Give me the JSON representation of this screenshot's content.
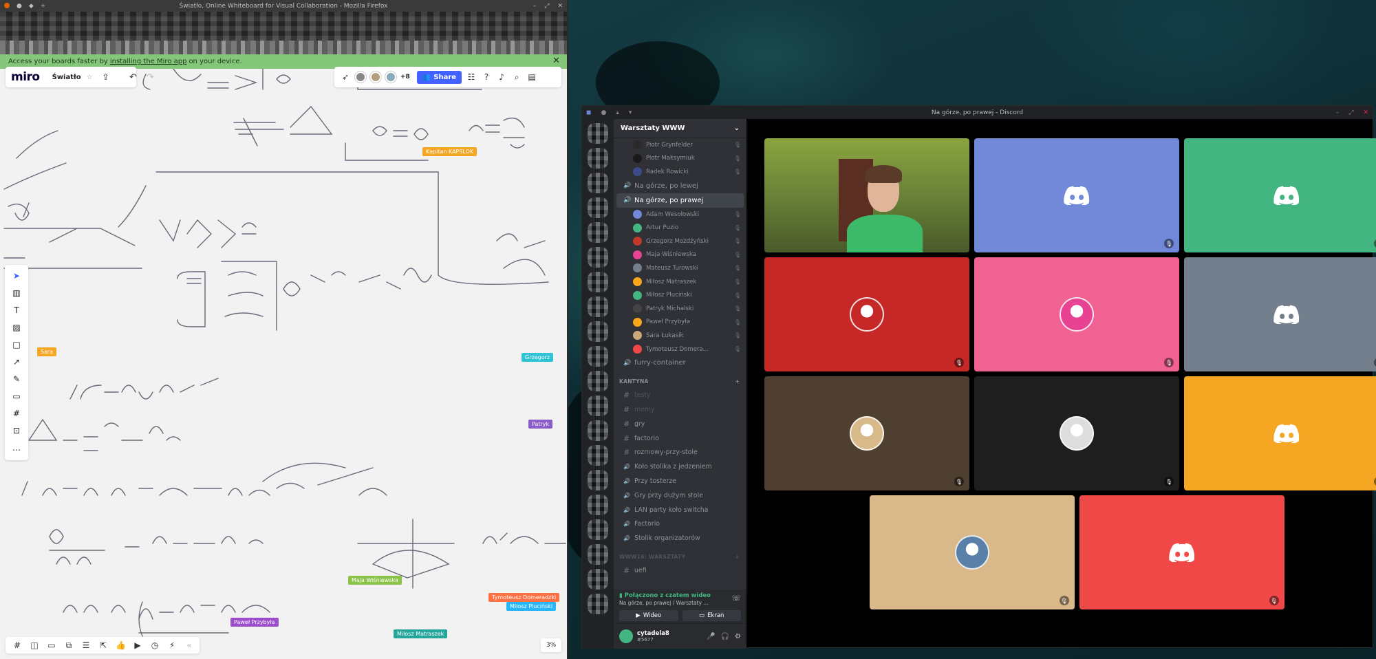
{
  "firefox": {
    "title": "Światło, Online Whiteboard for Visual Collaboration - Mozilla Firefox"
  },
  "miro": {
    "banner": {
      "text_before": "Access your boards faster by",
      "link": "installing the Miro app",
      "text_after": "on your device."
    },
    "logo": "miro",
    "board_name": "Światło",
    "collaborators_more": "+8",
    "share_label": "Share",
    "zoom": "3%",
    "cursors": [
      {
        "name": "Kapitan KAPSLOK",
        "color": "#f5a623"
      },
      {
        "name": "Sara",
        "color": "#f5a623"
      },
      {
        "name": "Grzegorz",
        "color": "#2fc3d6"
      },
      {
        "name": "Patryk",
        "color": "#8a5cc7"
      },
      {
        "name": "Maja Wiśniewska",
        "color": "#8bc34a"
      },
      {
        "name": "Paweł Przybyła",
        "color": "#9c4dcc"
      },
      {
        "name": "Miłosz Matraszek",
        "color": "#26a69a"
      },
      {
        "name": "Tymoteusz Domeradzki",
        "color": "#ff7043"
      },
      {
        "name": "Miłosz Pluciński",
        "color": "#29b6f6"
      }
    ]
  },
  "discord": {
    "window_title": "Na górze, po prawej - Discord",
    "server_name": "Warsztaty WWW",
    "top_users": [
      {
        "name": "Piotr Grynfelder",
        "color": "#2a2a2a"
      },
      {
        "name": "Piotr Maksymiuk",
        "color": "#1a1a1a"
      },
      {
        "name": "Radek Rowicki",
        "color": "#3a4a8a"
      }
    ],
    "voice_channels": [
      {
        "name": "Na górze, po lewej",
        "active": false
      },
      {
        "name": "Na górze, po prawej",
        "active": true
      }
    ],
    "channel_users": [
      {
        "name": "Adam Wesołowski",
        "color": "#7289da"
      },
      {
        "name": "Artur Puzio",
        "color": "#43b581"
      },
      {
        "name": "Grzegorz Możdżyński",
        "color": "#c0392b"
      },
      {
        "name": "Maja Wiśniewska",
        "color": "#e84393"
      },
      {
        "name": "Mateusz Turowski",
        "color": "#747f8d"
      },
      {
        "name": "Miłosz Matraszek",
        "color": "#faa61a"
      },
      {
        "name": "Miłosz Pluciński",
        "color": "#43b581"
      },
      {
        "name": "Patryk Michalski",
        "color": "#444"
      },
      {
        "name": "Paweł Przybyła",
        "color": "#faa61a"
      },
      {
        "name": "Sara Łukasik",
        "color": "#c9a97a"
      },
      {
        "name": "Tymoteusz Domera...",
        "color": "#f04747"
      }
    ],
    "other_voice_channel": "furry-container",
    "category_kantyna": "KANTYNA",
    "text_channels": [
      {
        "name": "testy",
        "muted": true,
        "icon": "hash"
      },
      {
        "name": "memy",
        "muted": true,
        "icon": "hash"
      },
      {
        "name": "gry",
        "muted": false,
        "icon": "hash"
      },
      {
        "name": "factorio",
        "muted": false,
        "icon": "hash"
      },
      {
        "name": "rozmowy-przy-stole",
        "muted": false,
        "icon": "hash"
      },
      {
        "name": "Koło stolika z jedzeniem",
        "muted": false,
        "icon": "speaker"
      },
      {
        "name": "Przy tosterze",
        "muted": false,
        "icon": "speaker"
      },
      {
        "name": "Gry przy dużym stole",
        "muted": false,
        "icon": "speaker"
      },
      {
        "name": "LAN party koło switcha",
        "muted": false,
        "icon": "speaker"
      },
      {
        "name": "Factorio",
        "muted": false,
        "icon": "speaker"
      },
      {
        "name": "Stolik organizatorów",
        "muted": false,
        "icon": "speaker"
      }
    ],
    "category_warsztaty": "WWW16: WARSZTATY",
    "uefi_channel": "uefi",
    "voice_connection": {
      "status": "Połączono z czatem wideo",
      "channel": "Na górze, po prawej / Warsztaty ...",
      "video_label": "Wideo",
      "screen_label": "Ekran"
    },
    "user": {
      "name": "cytadela8",
      "tag": "#5677"
    },
    "tiles": [
      {
        "bg": "#6f8a3a",
        "kind": "video"
      },
      {
        "bg": "#7289da",
        "kind": "logo"
      },
      {
        "bg": "#43b581",
        "kind": "logo"
      },
      {
        "bg": "#c62828",
        "kind": "avatar",
        "avatar": "#c62828"
      },
      {
        "bg": "#f06292",
        "kind": "avatar",
        "avatar": "#e84393"
      },
      {
        "bg": "#747f8d",
        "kind": "logo"
      },
      {
        "bg": "#4e3f30",
        "kind": "avatar",
        "avatar": "#d8b98a"
      },
      {
        "bg": "#1e1e1e",
        "kind": "avatar",
        "avatar": "#ddd"
      },
      {
        "bg": "#f5a623",
        "kind": "logo"
      },
      {
        "bg": "#d9b98a",
        "kind": "avatar",
        "avatar": "#5a7fa8"
      },
      {
        "bg": "#f04747",
        "kind": "logo"
      }
    ]
  }
}
